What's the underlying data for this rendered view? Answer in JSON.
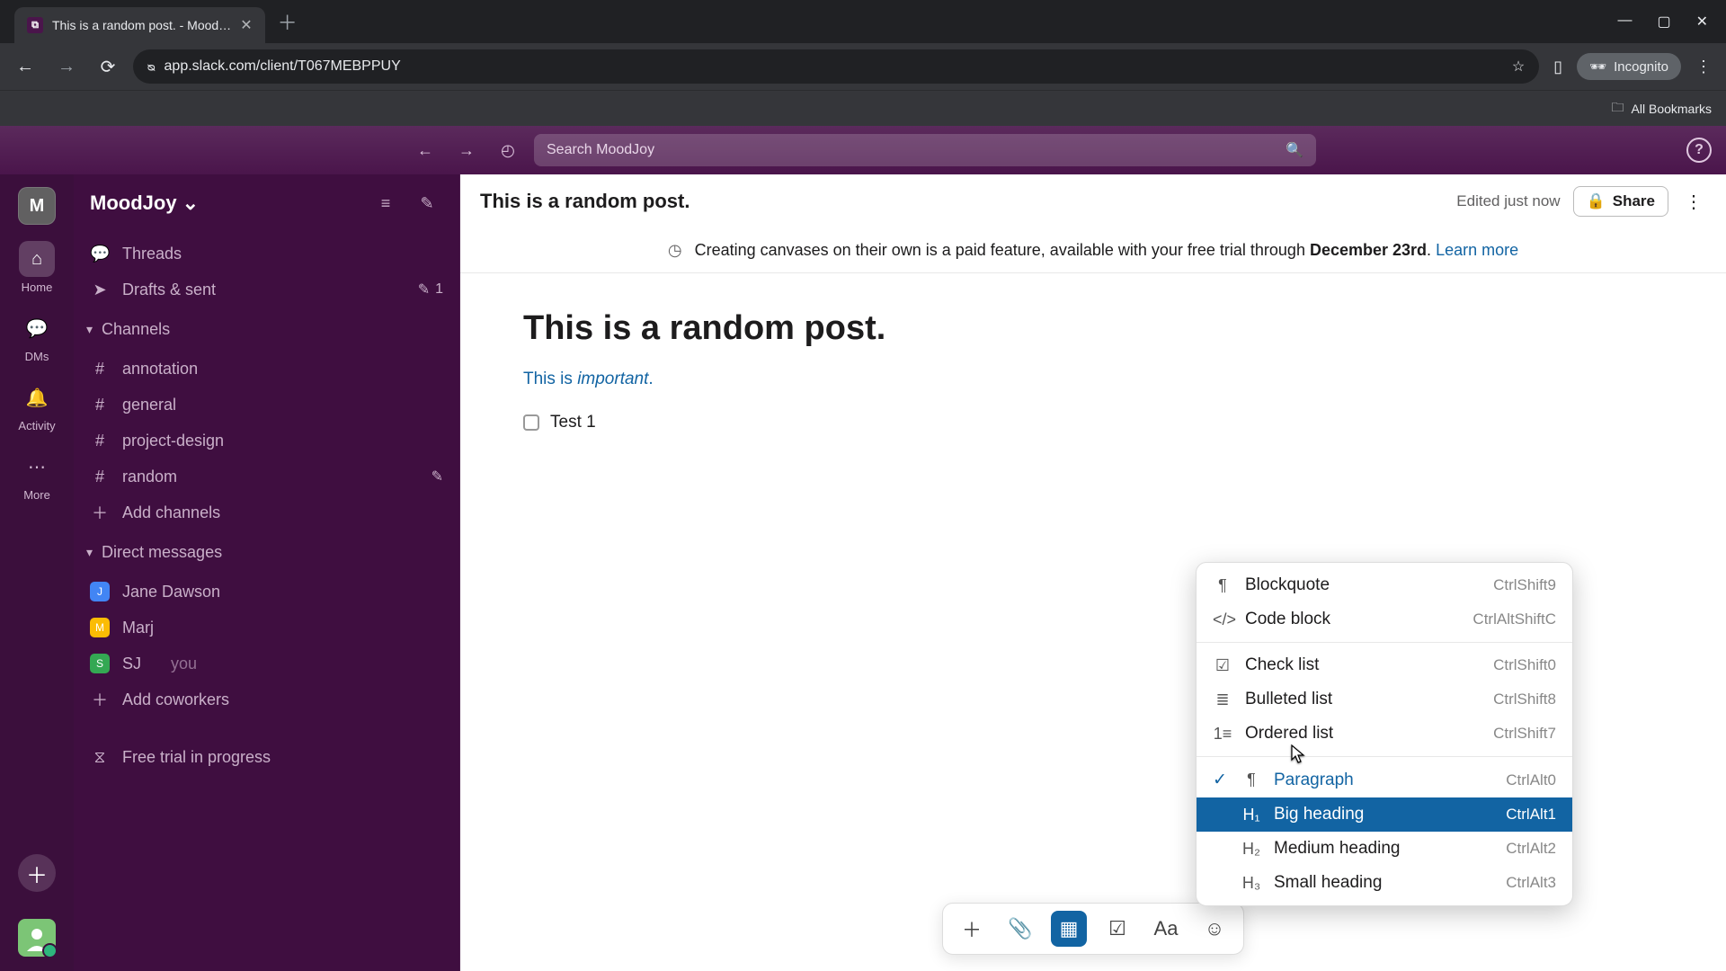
{
  "browser": {
    "tab_title": "This is a random post. - Mood…",
    "url": "app.slack.com/client/T067MEBPPUY",
    "incognito_label": "Incognito",
    "all_bookmarks": "All Bookmarks"
  },
  "slack_top": {
    "search_placeholder": "Search MoodJoy"
  },
  "rail": {
    "workspace_letter": "M",
    "items": [
      {
        "label": "Home"
      },
      {
        "label": "DMs"
      },
      {
        "label": "Activity"
      },
      {
        "label": "More"
      }
    ]
  },
  "sidebar": {
    "workspace_name": "MoodJoy",
    "threads": "Threads",
    "drafts": "Drafts & sent",
    "drafts_count": "1",
    "channels_header": "Channels",
    "channels": [
      "annotation",
      "general",
      "project-design",
      "random"
    ],
    "add_channels": "Add channels",
    "dms_header": "Direct messages",
    "dms": [
      {
        "name": "Jane Dawson"
      },
      {
        "name": "Marj"
      },
      {
        "name": "SJ",
        "suffix": "you"
      }
    ],
    "add_coworkers": "Add coworkers",
    "trial": "Free trial in progress"
  },
  "doc": {
    "header_title": "This is a random post.",
    "edited": "Edited just now",
    "share": "Share",
    "banner_text_a": "Creating canvases on their own is a paid feature, available with your free trial through ",
    "banner_date": "December 23rd",
    "banner_text_b": ". ",
    "banner_link": "Learn more",
    "body_title": "This is a random post.",
    "body_line_prefix": "This is ",
    "body_line_em": "important",
    "body_line_suffix": ".",
    "check_item": "Test 1"
  },
  "dropdown": {
    "items": [
      {
        "icon": "❝",
        "label": "Blockquote",
        "short": "CtrlShift9"
      },
      {
        "icon": "⟨/⟩",
        "label": "Code block",
        "short": "CtrlAltShiftC"
      },
      {
        "sep": true
      },
      {
        "icon": "☑",
        "label": "Check list",
        "short": "CtrlShift0"
      },
      {
        "icon": "≣",
        "label": "Bulleted list",
        "short": "CtrlShift8"
      },
      {
        "icon": "1≡",
        "label": "Ordered list",
        "short": "CtrlShift7"
      },
      {
        "sep": true
      },
      {
        "icon": "¶",
        "label": "Paragraph",
        "short": "CtrlAlt0",
        "selected": true
      },
      {
        "icon": "H₁",
        "label": "Big heading",
        "short": "CtrlAlt1",
        "highlight": true
      },
      {
        "icon": "H₂",
        "label": "Medium heading",
        "short": "CtrlAlt2"
      },
      {
        "icon": "H₃",
        "label": "Small heading",
        "short": "CtrlAlt3"
      }
    ]
  }
}
